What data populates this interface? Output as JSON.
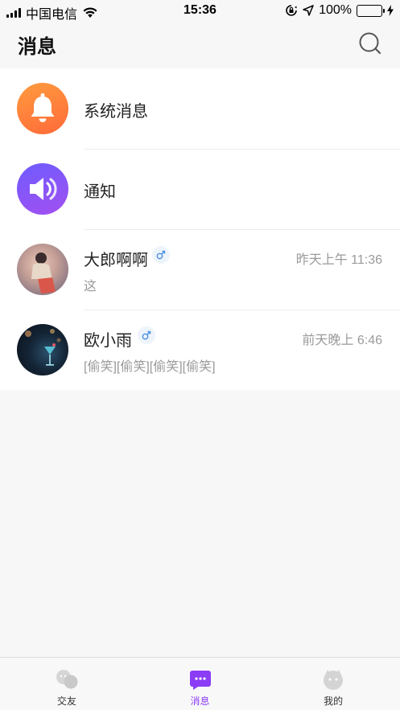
{
  "status_bar": {
    "carrier": "中国电信",
    "time": "15:36",
    "battery_percent": "100%",
    "battery_level": 1.0,
    "icons": [
      "signal-icon",
      "wifi-icon",
      "orientation-lock-icon",
      "location-icon",
      "battery-icon",
      "charging-icon"
    ]
  },
  "header": {
    "title": "消息",
    "search_icon": "search-icon"
  },
  "messages": [
    {
      "title": "系统消息",
      "icon": "bell-icon",
      "accent": "#ff7a3b"
    },
    {
      "title": "通知",
      "icon": "speaker-icon",
      "accent": "#8a56f7"
    },
    {
      "name": "大郎啊啊",
      "gender_icon": "male-icon",
      "time": "昨天上午 11:36",
      "preview": "这"
    },
    {
      "name": "欧小雨",
      "gender_icon": "male-icon",
      "time": "前天晚上 6:46",
      "preview": "[偷笑][偷笑][偷笑][偷笑]"
    }
  ],
  "tabbar": {
    "tabs": [
      {
        "label": "交友",
        "icon": "chat-bubbles-icon",
        "active": false
      },
      {
        "label": "消息",
        "icon": "message-icon",
        "active": true
      },
      {
        "label": "我的",
        "icon": "profile-face-icon",
        "active": false
      }
    ],
    "active_color": "#8b3cf5"
  }
}
